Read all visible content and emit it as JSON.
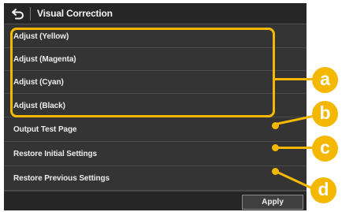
{
  "header": {
    "title": "Visual Correction",
    "back_icon": "back-arrow-icon"
  },
  "items": [
    {
      "label": "Adjust (Yellow)"
    },
    {
      "label": "Adjust (Magenta)"
    },
    {
      "label": "Adjust (Cyan)"
    },
    {
      "label": "Adjust (Black)"
    },
    {
      "label": "Output Test Page"
    },
    {
      "label": "Restore Initial Settings"
    },
    {
      "label": "Restore Previous Settings"
    }
  ],
  "footer": {
    "apply_label": "Apply"
  },
  "callouts": [
    "a",
    "b",
    "c",
    "d"
  ],
  "colors": {
    "accent": "#f5b800",
    "panel": "#2e2e2e",
    "row": "#343434",
    "text": "#ececec"
  }
}
